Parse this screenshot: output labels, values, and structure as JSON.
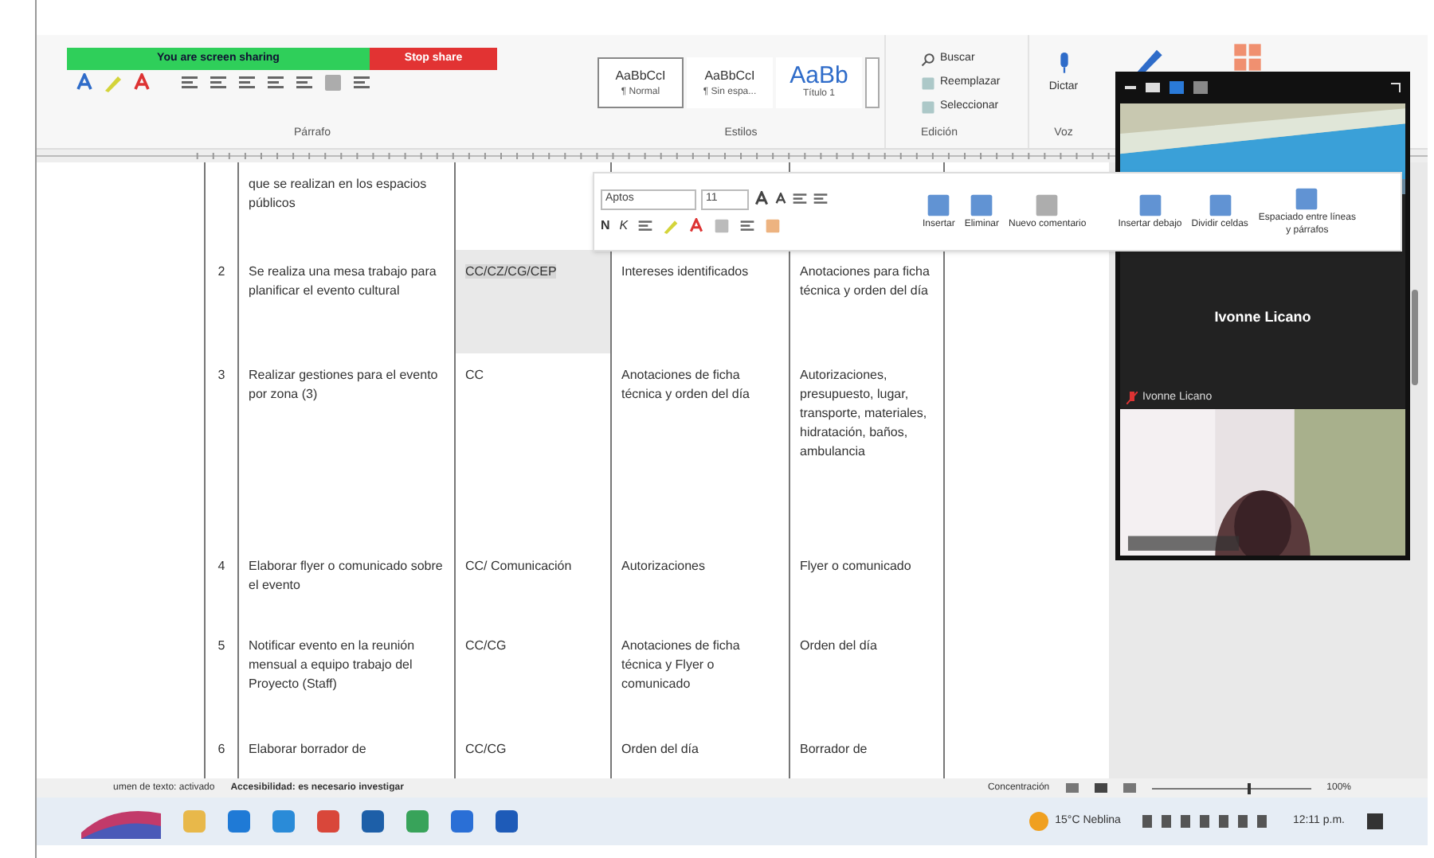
{
  "share_bar": {
    "status": "You are screen sharing",
    "stop": "Stop share"
  },
  "ribbon": {
    "groups": [
      {
        "kind": "font"
      },
      {
        "kind": "paragraph",
        "label": "Párrafo"
      },
      {
        "kind": "styles",
        "label": "Estilos"
      },
      {
        "kind": "editing",
        "label": "Edición"
      },
      {
        "kind": "voice",
        "label": "Voz"
      }
    ],
    "styles": [
      {
        "sample": "AaBbCcI",
        "name": "¶ Normal",
        "selected": true,
        "large": false
      },
      {
        "sample": "AaBbCcI",
        "name": "¶ Sin espa...",
        "selected": false,
        "large": false
      },
      {
        "sample": "AaBb",
        "name": "Título 1",
        "selected": false,
        "large": true
      }
    ],
    "editing": [
      "Buscar",
      "Reemplazar",
      "Seleccionar"
    ],
    "dictate": "Dictar"
  },
  "table": {
    "rows": [
      {
        "number": "",
        "activity": "que se realizan en los espacios públicos",
        "responsible": "",
        "input": "",
        "output": "",
        "selected": false
      },
      {
        "number": "2",
        "activity": "Se realiza una mesa trabajo para planificar el evento cultural",
        "responsible": "CC/CZ/CG/CEP",
        "input": "Intereses identificados",
        "output": "Anotaciones para ficha técnica y orden del día",
        "selected": true
      },
      {
        "number": "3",
        "activity": "Realizar gestiones para el evento por zona (3)",
        "responsible": "CC",
        "input": "Anotaciones de ficha técnica y orden del día",
        "output": "Autorizaciones, presupuesto, lugar, transporte, materiales, hidratación, baños, ambulancia",
        "selected": false
      },
      {
        "number": "4",
        "activity": "Elaborar flyer o comunicado sobre el evento",
        "responsible": "CC/ Comunicación",
        "input": "Autorizaciones",
        "output": "Flyer o comunicado",
        "selected": false
      },
      {
        "number": "5",
        "activity": "Notificar evento en la reunión mensual a equipo trabajo del Proyecto (Staff)",
        "responsible": "CC/CG",
        "input": "Anotaciones de ficha técnica y Flyer o comunicado",
        "output": "Orden del día",
        "selected": false
      },
      {
        "number": "6",
        "activity": "Elaborar borrador de",
        "responsible": "CC/CG",
        "input": "Orden del día",
        "output": "Borrador de",
        "selected": false
      }
    ]
  },
  "mini_toolbar": {
    "font": "Aptos",
    "size": "11",
    "bold": "N",
    "italic": "K",
    "actions": [
      "Insertar",
      "Eliminar",
      "Nuevo comentario",
      "Insertar debajo",
      "Dividir celdas",
      "Espaciado entre líneas y párrafos"
    ]
  },
  "meeting": {
    "tiles": [
      {
        "kind": "video"
      },
      {
        "kind": "name",
        "name": "Ivonne Licano",
        "label": "Ivonne Licano",
        "muted": true
      },
      {
        "kind": "video"
      }
    ]
  },
  "status_bar": {
    "left": "umen de texto: activado",
    "accessibility": "Accesibilidad: es necesario investigar",
    "focus": "Concentración",
    "zoom_slider": {
      "level": 0.6
    },
    "zoom": "100%"
  },
  "taskbar": {
    "apps": [
      {
        "color": "#e8b84a"
      },
      {
        "color": "#1f7ad6"
      },
      {
        "color": "#2a8bd8"
      },
      {
        "color": "#d9473a"
      },
      {
        "color": "#1d5fa8"
      },
      {
        "color": "#38a35a"
      },
      {
        "color": "#2a6fd6"
      },
      {
        "color": "#1e5bb8"
      }
    ],
    "weather": "15°C Neblina",
    "time": "12:11 p.m."
  }
}
